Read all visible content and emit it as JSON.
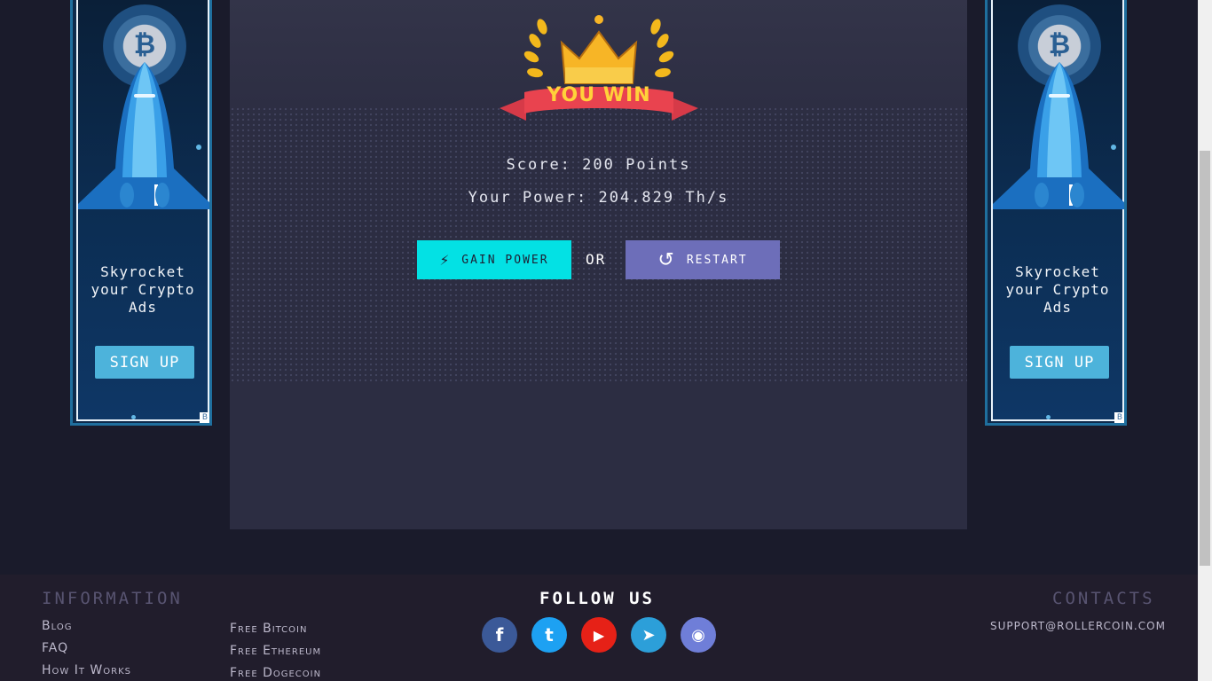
{
  "ad": {
    "coin_symbol": "₿",
    "text": "Skyrocket your Crypto Ads",
    "button_label": "SIGN UP",
    "badge": "B"
  },
  "game": {
    "banner_text": "YOU WIN",
    "score_text": "Score: 200 Points",
    "power_text": "Your Power: 204.829 Th/s",
    "gain_button_label": "Gain Power",
    "or_text": "or",
    "restart_button_label": "Restart"
  },
  "footer": {
    "information_title": "Information",
    "information_links": [
      "Blog",
      "FAQ",
      "How It Works"
    ],
    "free_links": [
      "Free Bitcoin",
      "Free Ethereum",
      "Free Dogecoin"
    ],
    "follow_title": "Follow us",
    "social": [
      {
        "name": "facebook",
        "glyph": "f",
        "color": "#3b5998"
      },
      {
        "name": "twitter",
        "glyph": "t",
        "color": "#1da1f2"
      },
      {
        "name": "youtube",
        "glyph": "▶",
        "color": "#e62117"
      },
      {
        "name": "telegram",
        "glyph": "➤",
        "color": "#2c9fd9"
      },
      {
        "name": "discord",
        "glyph": "◉",
        "color": "#6f7ed8"
      }
    ],
    "contacts_title": "Contacts",
    "email": "support@rollercoin.com"
  },
  "colors": {
    "background": "#1a1b2b",
    "panel": "#2c2d42",
    "gain_button": "#03e1e4",
    "restart_button": "#6d6eb9",
    "ad_button": "#4db3db",
    "footer": "#211d2c"
  }
}
